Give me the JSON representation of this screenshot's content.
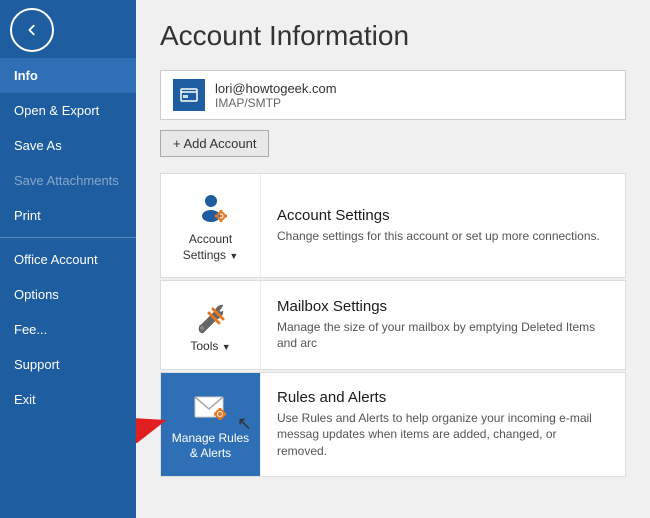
{
  "sidebar": {
    "back_aria": "Back",
    "items": [
      {
        "id": "info",
        "label": "Info",
        "active": true,
        "disabled": false
      },
      {
        "id": "open-export",
        "label": "Open & Export",
        "active": false,
        "disabled": false
      },
      {
        "id": "save-as",
        "label": "Save As",
        "active": false,
        "disabled": false
      },
      {
        "id": "save-attachments",
        "label": "Save Attachments",
        "active": false,
        "disabled": true
      },
      {
        "id": "print",
        "label": "Print",
        "active": false,
        "disabled": false
      },
      {
        "id": "office-account",
        "label": "Office Account",
        "active": false,
        "disabled": false
      },
      {
        "id": "options",
        "label": "Options",
        "active": false,
        "disabled": false
      },
      {
        "id": "feedback",
        "label": "Fee...",
        "active": false,
        "disabled": false
      },
      {
        "id": "support",
        "label": "Support",
        "active": false,
        "disabled": false
      },
      {
        "id": "exit",
        "label": "Exit",
        "active": false,
        "disabled": false
      }
    ]
  },
  "main": {
    "page_title": "Account Information",
    "account": {
      "email": "lori@howtogeek.com",
      "type": "IMAP/SMTP"
    },
    "add_account_label": "+ Add Account",
    "cards": [
      {
        "id": "account-settings",
        "icon_label": "Account Settings",
        "show_arrow": true,
        "title": "Account Settings",
        "desc": "Change settings for this account or set up more connections.",
        "highlighted": false
      },
      {
        "id": "mailbox-settings",
        "icon_label": "Tools",
        "show_arrow": true,
        "title": "Mailbox Settings",
        "desc": "Manage the size of your mailbox by emptying Deleted Items and arc",
        "highlighted": false
      },
      {
        "id": "rules-alerts",
        "icon_label": "Manage Rules & Alerts",
        "show_arrow": false,
        "title": "Rules and Alerts",
        "desc": "Use Rules and Alerts to help organize your incoming e-mail messag updates when items are added, changed, or removed.",
        "highlighted": true
      }
    ]
  },
  "colors": {
    "sidebar_bg": "#1e5da0",
    "sidebar_active": "#2e6fb5",
    "highlight_bg": "#2e6fb5",
    "accent": "#1e5da0"
  }
}
